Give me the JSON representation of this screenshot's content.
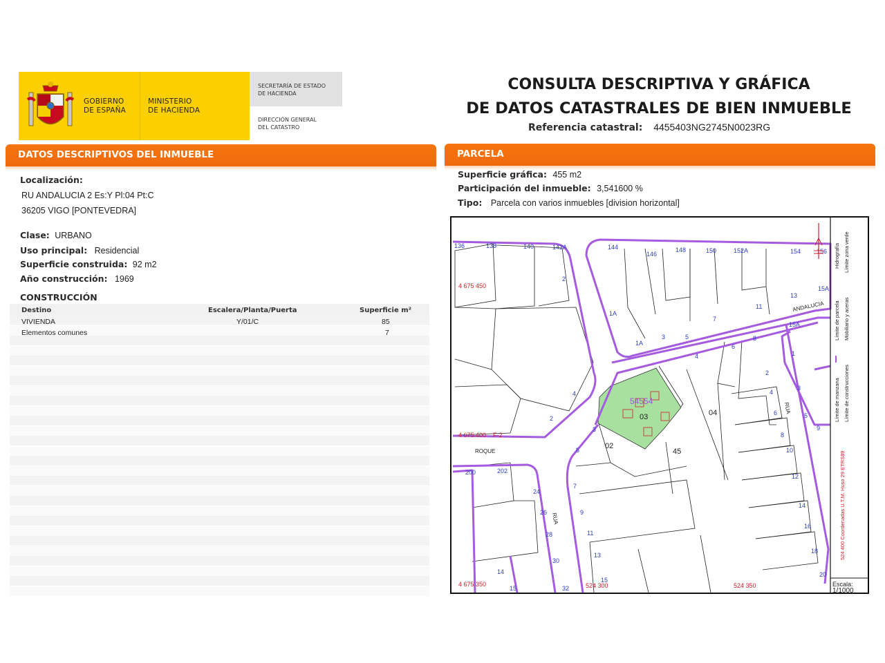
{
  "header": {
    "gov_line1": "GOBIERNO",
    "gov_line2": "DE ESPAÑA",
    "ministry_line1": "MINISTERIO",
    "ministry_line2": "DE HACIENDA",
    "secretaria_line1": "SECRETARÍA DE ESTADO",
    "secretaria_line2": "DE HACIENDA",
    "direccion_line1": "DIRECCIÓN GENERAL",
    "direccion_line2": "DEL CATASTRO",
    "title_line1": "CONSULTA DESCRIPTIVA Y GRÁFICA",
    "title_line2": "DE DATOS CATASTRALES DE BIEN INMUEBLE",
    "ref_label": "Referencia catastral:",
    "ref_value": "4455403NG2745N0023RG",
    "brand_red": "#c60b1e",
    "brand_yellow": "#fcd000"
  },
  "left": {
    "section_title": "DATOS DESCRIPTIVOS DEL INMUEBLE",
    "section_color": "#f26d0f",
    "loc_label": "Localización:",
    "loc_line1": "RU ANDALUCIA 2 Es:Y Pl:04 Pt:C",
    "loc_line2": "36205 VIGO [PONTEVEDRA]",
    "clase_label": "Clase:",
    "clase_value": "URBANO",
    "uso_label": "Uso principal:",
    "uso_value": "Residencial",
    "sup_label": "Superficie construida:",
    "sup_value": "92 m2",
    "anio_label": "Año construcción:",
    "anio_value": "1969",
    "construccion_title": "CONSTRUCCIÓN",
    "table": {
      "headers": [
        "Destino",
        "Escalera/Planta/Puerta",
        "Superficie m²"
      ],
      "rows": [
        [
          "VIVIENDA",
          "Y/01/C",
          "85"
        ],
        [
          "Elementos comunes",
          "",
          "7"
        ]
      ]
    }
  },
  "right": {
    "section_title": "PARCELA",
    "sup_label": "Superficie gráfica:",
    "sup_value": "455 m2",
    "part_label": "Participación del inmueble:",
    "part_value": "3,541600 %",
    "tipo_label": "Tipo:",
    "tipo_value": "Parcela con varios inmuebles [division horizontal]"
  },
  "map": {
    "street_roque": "ROQUE",
    "street_andalucia": "ANDALUCIA",
    "street_rua1": "RUA",
    "street_rua2": "RUA",
    "parcel_id": "54554",
    "parcel_03": "03",
    "parcel_02": "02",
    "parcel_04": "04",
    "parcel_45": "45",
    "coord_y1": "4 675 450",
    "coord_y2": "4 675 400",
    "coord_y3": "4 675 350",
    "coord_x1": "524 300",
    "coord_x2": "524 350",
    "street_f2": "F-2",
    "house_numbers_top": [
      "136",
      "138",
      "140",
      "142A",
      "144",
      "146",
      "148",
      "150",
      "152A",
      "154",
      "156"
    ],
    "legend_manzana": "Límite de manzana",
    "legend_parcela": "Límite de parcela",
    "legend_construcciones": "Límite de construcciones",
    "legend_mobiliario": "Mobiliario y aceras",
    "legend_verde": "Límite zona verde",
    "legend_hidrografia": "Hidrografía",
    "legend_coord": "524 400 Coordenadas U.T.M. Huso 29 ETRS89",
    "escala_label": "Escala:",
    "escala_value": "1/1000",
    "parcel_green": "#a8e0a0",
    "manzana_purple": "#a55be0"
  }
}
